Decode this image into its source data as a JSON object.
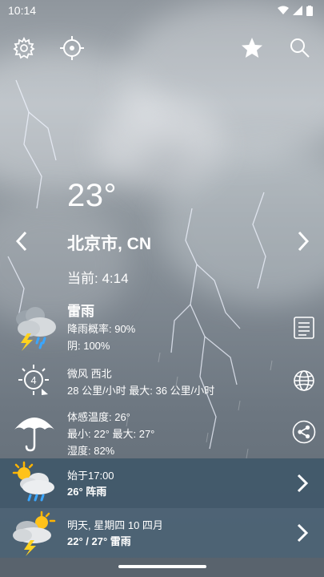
{
  "status_bar": {
    "time": "10:14"
  },
  "weather": {
    "temperature": "23°",
    "city": "北京市, CN",
    "current_time": "当前: 4:14"
  },
  "conditions": {
    "title": "雷雨",
    "rain_chance": "降雨概率: 90%",
    "cloud_cover": "阴: 100%"
  },
  "wind": {
    "bft": "4",
    "description": "微风 西北",
    "speed": "28 公里/小时 最大: 36 公里/小时"
  },
  "feels": {
    "feels_like": "体感温度: 26°",
    "min_max": "最小: 22° 最大: 27°",
    "humidity": "湿度: 82%"
  },
  "forecast": [
    {
      "line1": "始于17:00",
      "line2": "26° 阵雨"
    },
    {
      "line1": "明天, 星期四 10 四月",
      "line2": "22° / 27° 雷雨"
    }
  ],
  "icons": {
    "settings": "gear-icon",
    "location": "crosshair-icon",
    "favorite": "star-icon",
    "search": "search-icon",
    "details": "document-icon",
    "globe": "globe-icon",
    "share": "share-icon"
  },
  "colors": {
    "forecast_band_1": "#3d5668",
    "forecast_band_2": "#4a6274"
  }
}
